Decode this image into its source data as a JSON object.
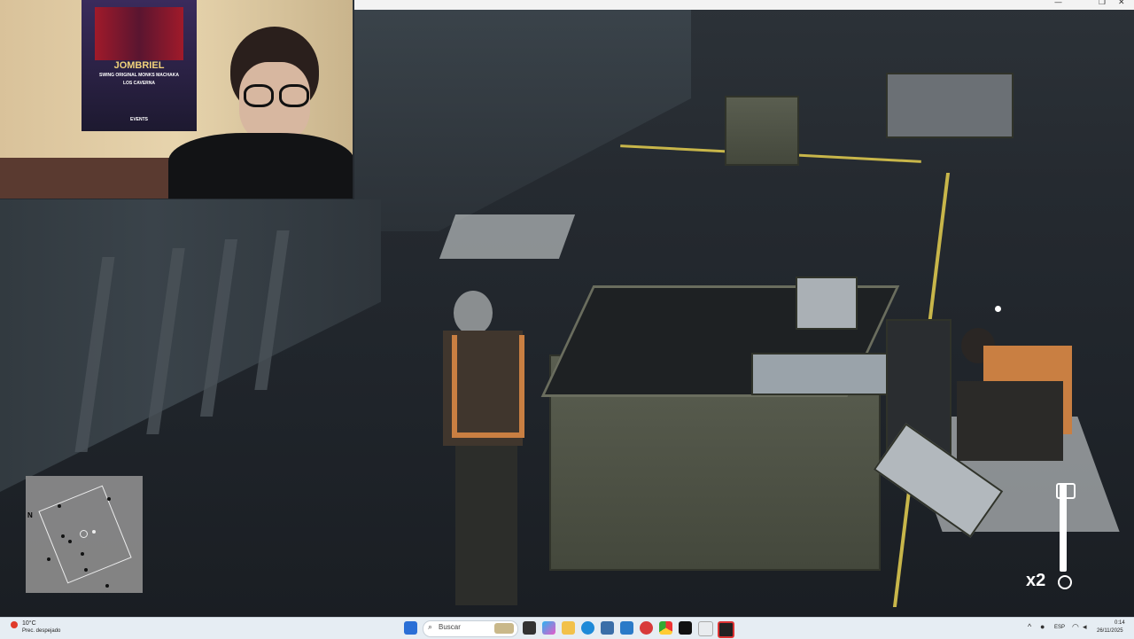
{
  "webcam_poster": {
    "title": "JOMBRIEL",
    "line1": "SWING ORIGINAL MONKS MACHAKA",
    "line2": "LOS CAVERNA",
    "footer": "EVENTS"
  },
  "game_hud": {
    "item_count": "x2",
    "item_icon": "pipe-wrench-icon",
    "minimap_north": "N"
  },
  "taskbar": {
    "weather_temp": "10°C",
    "weather_desc": "Prec. despejado",
    "search_placeholder": "Buscar",
    "language": "ESP",
    "time": "0:14",
    "date": "26/11/2025",
    "icons": [
      "start-icon",
      "search-icon",
      "task-view-icon",
      "copilot-icon",
      "file-explorer-icon",
      "edge-icon",
      "store-icon",
      "mail-icon",
      "media-icon",
      "chrome-icon",
      "app-icon",
      "app-icon-2",
      "epic-games-icon"
    ]
  }
}
